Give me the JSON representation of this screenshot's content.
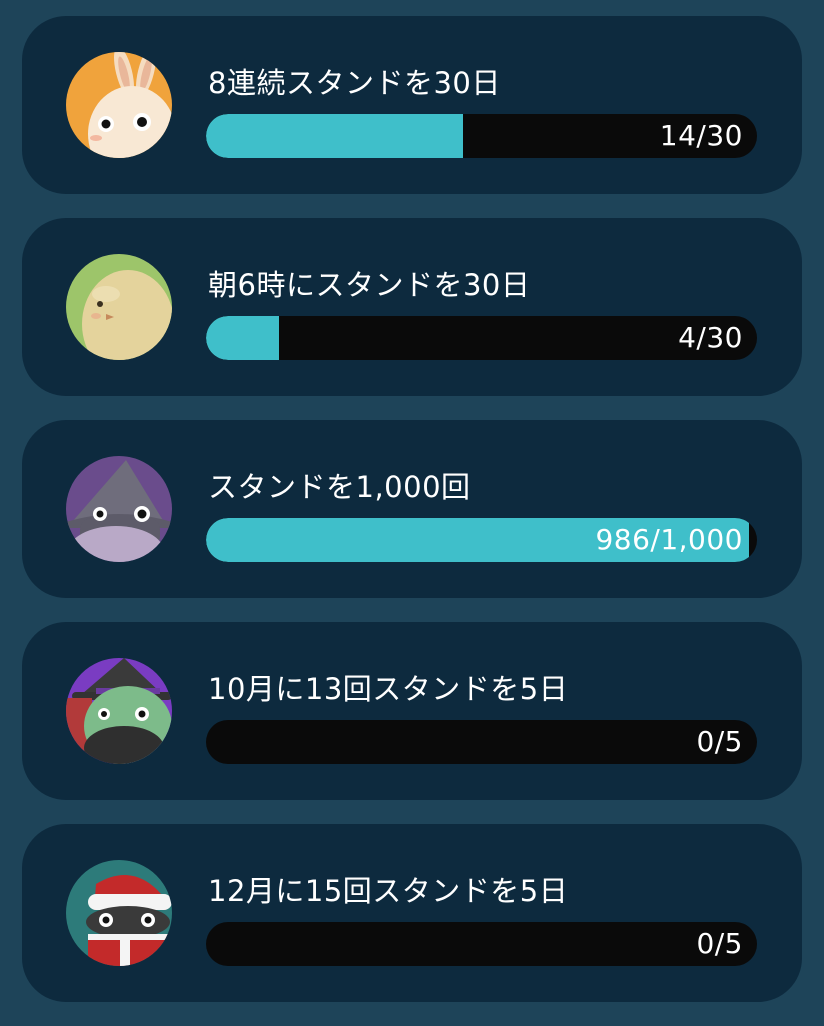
{
  "challenges": [
    {
      "title": "8連続スタンドを30日",
      "progress_text": "14/30",
      "progress": 14,
      "goal": 30,
      "icon": "rabbit-avatar-icon",
      "avatar_color": "#f0a33c"
    },
    {
      "title": "朝6時にスタンドを30日",
      "progress_text": "4/30",
      "progress": 4,
      "goal": 30,
      "icon": "egg-bird-avatar-icon",
      "avatar_color": "#9dc56a"
    },
    {
      "title": "スタンドを1,000回",
      "progress_text": "986/1,000",
      "progress": 986,
      "goal": 1000,
      "icon": "wizard-avatar-icon",
      "avatar_color": "#6a4c8c"
    },
    {
      "title": "10月に13回スタンドを5日",
      "progress_text": "0/5",
      "progress": 0,
      "goal": 5,
      "icon": "witch-avatar-icon",
      "avatar_color": "#7a3cc2"
    },
    {
      "title": "12月に15回スタンドを5日",
      "progress_text": "0/5",
      "progress": 0,
      "goal": 5,
      "icon": "santa-avatar-icon",
      "avatar_color": "#2d7b7a"
    }
  ],
  "colors": {
    "background": "#1e4459",
    "card": "#0d2a3e",
    "bar_track": "#0a0a0a",
    "bar_fill": "#3fbfca",
    "text": "#ffffff"
  }
}
